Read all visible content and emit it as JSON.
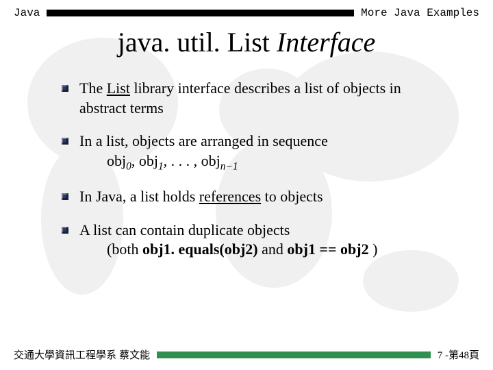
{
  "header": {
    "left": "Java",
    "right": "More Java Examples"
  },
  "title": {
    "prefix": "java. util. List",
    "suffix": " Interface"
  },
  "bullets": {
    "b1a": "The ",
    "b1b": "List",
    "b1c": " library interface describes a list of objects in abstract terms",
    "b2": "In a list, objects are arranged in sequence",
    "seq": "obj",
    "seq_s0": "0",
    "seq_sep": ", obj",
    "seq_s1": "1",
    "seq_sep2": ", . . . , obj",
    "seq_sn": "n−1",
    "b3a": "In Java, a list holds ",
    "b3b": "references",
    "b3c": " to objects",
    "b4": "A list can contain duplicate objects",
    "b5a": "(both ",
    "b5b": "obj1. equals(obj2)",
    "b5c": " and ",
    "b5d": "obj1 == obj2",
    "b5e": " )"
  },
  "footer": {
    "left": "交通大學資訊工程學系 蔡文能",
    "right": "7 -第48頁"
  }
}
